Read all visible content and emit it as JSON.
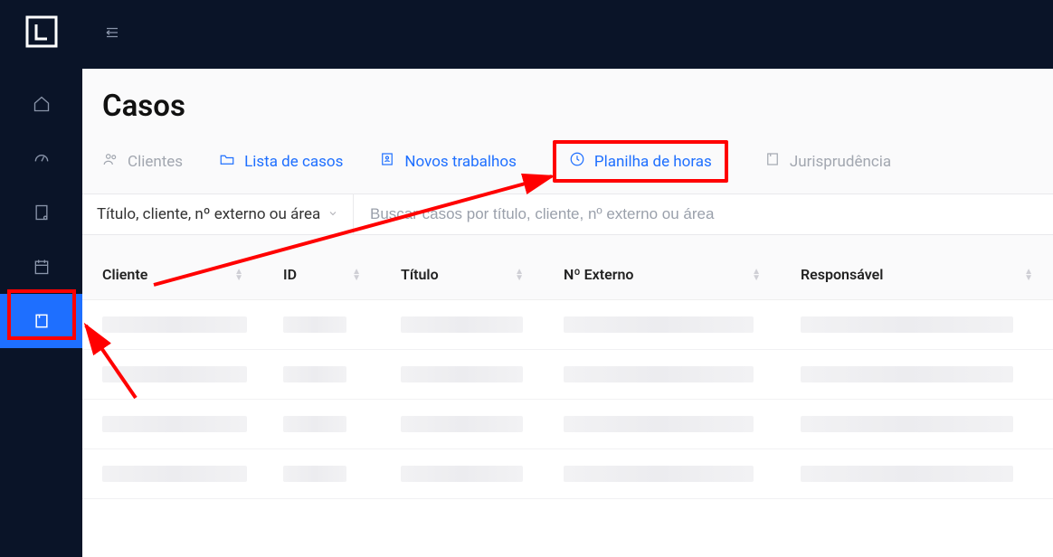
{
  "page": {
    "title": "Casos"
  },
  "tabs": {
    "clientes": "Clientes",
    "lista": "Lista de casos",
    "novos": "Novos trabalhos",
    "planilha": "Planilha de horas",
    "juris": "Jurisprudência"
  },
  "filter": {
    "select_label": "Título, cliente, nº externo ou área",
    "search_placeholder": "Buscar casos por título, cliente, nº externo ou área"
  },
  "columns": {
    "cliente": "Cliente",
    "id": "ID",
    "titulo": "Título",
    "externo": "Nº Externo",
    "resp": "Responsável"
  }
}
